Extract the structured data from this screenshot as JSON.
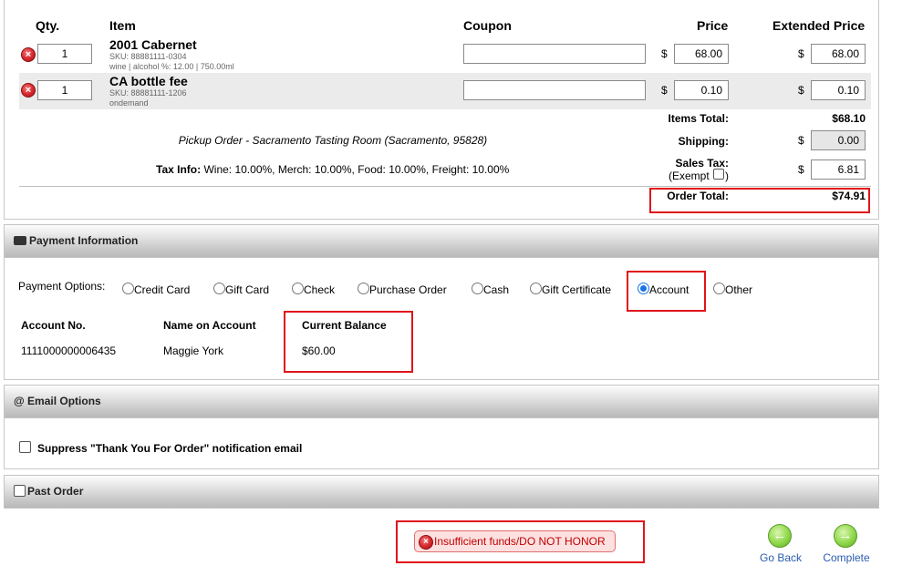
{
  "order": {
    "headers": {
      "qty": "Qty.",
      "item": "Item",
      "coupon": "Coupon",
      "price": "Price",
      "extended_price": "Extended Price"
    },
    "items": [
      {
        "qty": "1",
        "name": "2001 Cabernet",
        "sku": "SKU: 88881111-0304",
        "detail": "wine | alcohol %: 12.00 | 750.00ml",
        "coupon": "",
        "currency": "$",
        "price": "68.00",
        "extended_price": "68.00"
      },
      {
        "qty": "1",
        "name": "CA bottle fee",
        "sku": "SKU: 88881111-1206",
        "detail": "ondemand",
        "coupon": "",
        "currency": "$",
        "price": "0.10",
        "extended_price": "0.10"
      }
    ],
    "pickup_text": "Pickup Order - Sacramento Tasting Room (Sacramento, 95828)",
    "tax_info_label": "Tax Info:",
    "tax_info_text": "Wine: 10.00%, Merch: 10.00%, Food: 10.00%, Freight: 10.00%",
    "items_total_label": "Items Total:",
    "items_total_value": "$68.10",
    "shipping_label": "Shipping:",
    "shipping_currency": "$",
    "shipping_value": "0.00",
    "sales_tax_label": "Sales Tax:",
    "exempt_label": "(Exempt",
    "exempt_close": ")",
    "sales_tax_currency": "$",
    "sales_tax_value": "6.81",
    "order_total_label": "Order Total:",
    "order_total_value": "$74.91"
  },
  "payment": {
    "section_title": "Payment Information",
    "options_label": "Payment Options:",
    "options": [
      {
        "label": "Credit Card",
        "checked": false
      },
      {
        "label": "Gift Card",
        "checked": false
      },
      {
        "label": "Check",
        "checked": false
      },
      {
        "label": "Purchase Order",
        "checked": false
      },
      {
        "label": "Cash",
        "checked": false
      },
      {
        "label": "Gift Certificate",
        "checked": false
      },
      {
        "label": "Account",
        "checked": true
      },
      {
        "label": "Other",
        "checked": false
      }
    ],
    "account_no_label": "Account No.",
    "account_no_value": "1111000000006435",
    "name_label": "Name on Account",
    "name_value": "Maggie York",
    "balance_label": "Current Balance",
    "balance_value": "$60.00"
  },
  "email": {
    "section_title": "@ Email Options",
    "suppress_label": "Suppress \"Thank You For Order\" notification email"
  },
  "past_order": {
    "label": "Past Order"
  },
  "error": {
    "message": "Insufficient funds/DO NOT HONOR"
  },
  "nav": {
    "back_label": "Go Back",
    "complete_label": "Complete"
  },
  "colors": {
    "highlight_red": "#e0141b",
    "link_blue": "#2a5db0",
    "error_text": "#c00000"
  }
}
